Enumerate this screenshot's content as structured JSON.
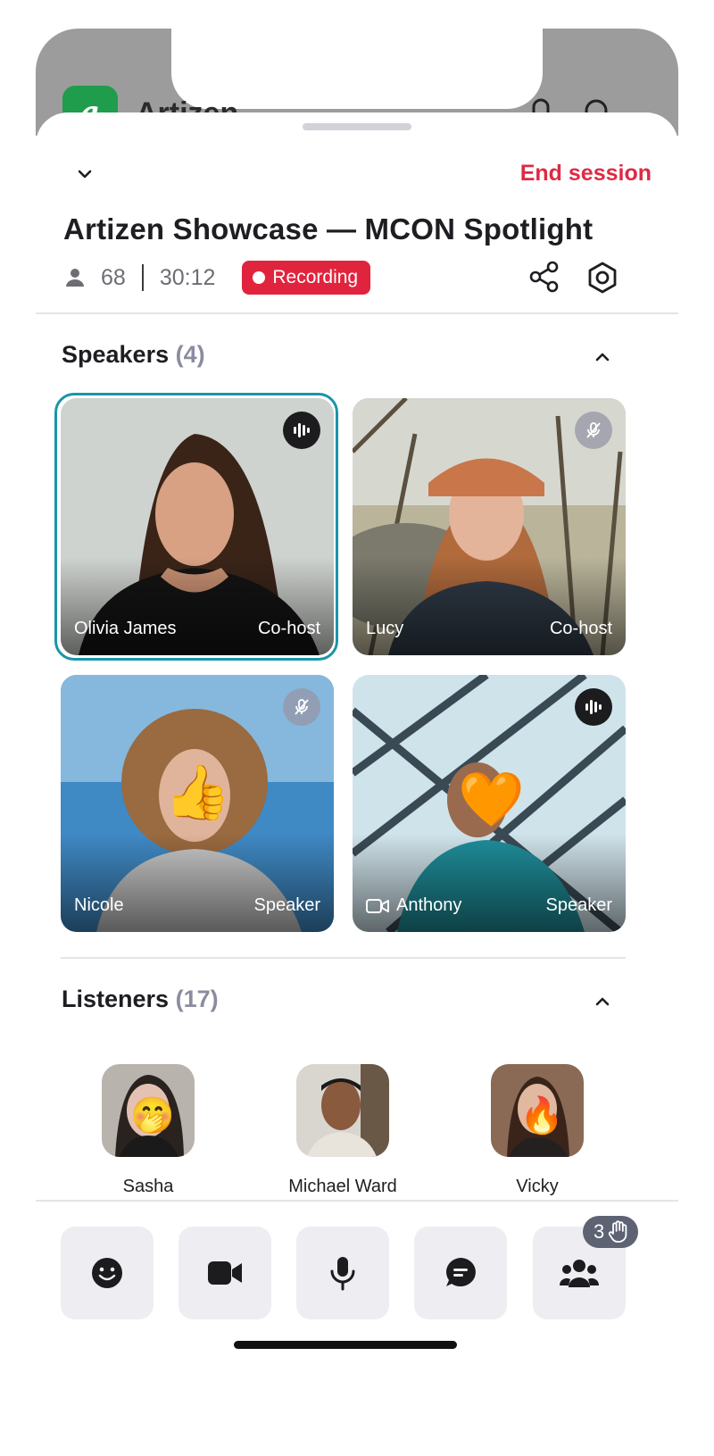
{
  "app": {
    "name": "Artizen",
    "logo_letter": "a"
  },
  "header": {
    "end_session_label": "End session"
  },
  "room": {
    "title": "Artizen Showcase — MCON Spotlight",
    "participant_count": "68",
    "elapsed": "30:12",
    "recording_label": "Recording"
  },
  "speakers": {
    "title": "Speakers",
    "count_label": "(4)",
    "items": [
      {
        "name": "Olivia James",
        "role": "Co-host",
        "status": "speaking",
        "active": true
      },
      {
        "name": "Lucy",
        "role": "Co-host",
        "status": "muted"
      },
      {
        "name": "Nicole",
        "role": "Speaker",
        "status": "muted",
        "reaction": "👍"
      },
      {
        "name": "Anthony",
        "role": "Speaker",
        "status": "speaking",
        "video": true,
        "reaction": "🧡"
      }
    ]
  },
  "listeners": {
    "title": "Listeners",
    "count_label": "(17)",
    "items": [
      {
        "name": "Sasha",
        "reaction": "🤭"
      },
      {
        "name": "Michael Ward"
      },
      {
        "name": "Vicky",
        "reaction": "🔥"
      }
    ]
  },
  "toolbar": {
    "buttons": [
      "emoji-icon",
      "video-camera-icon",
      "microphone-icon",
      "chat-icon",
      "people-icon"
    ],
    "raised_hands_count": "3"
  },
  "colors": {
    "accent_red": "#de2a44",
    "recording_red": "#e1243d",
    "active_ring": "#1a95a8",
    "brand_green": "#1f9d4c"
  }
}
